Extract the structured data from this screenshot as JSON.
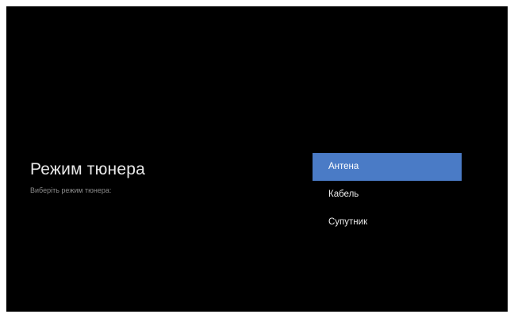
{
  "screen": {
    "title": "Режим тюнера",
    "subtitle": "Виберіть режим тюнера:"
  },
  "menu": {
    "items": [
      {
        "label": "Антена",
        "selected": true
      },
      {
        "label": "Кабель",
        "selected": false
      },
      {
        "label": "Супутник",
        "selected": false
      }
    ],
    "highlight_color": "#4a7bc6"
  },
  "colors": {
    "background": "#000000",
    "title_text": "#e8e8e8",
    "subtitle_text": "#8a8a8a"
  }
}
